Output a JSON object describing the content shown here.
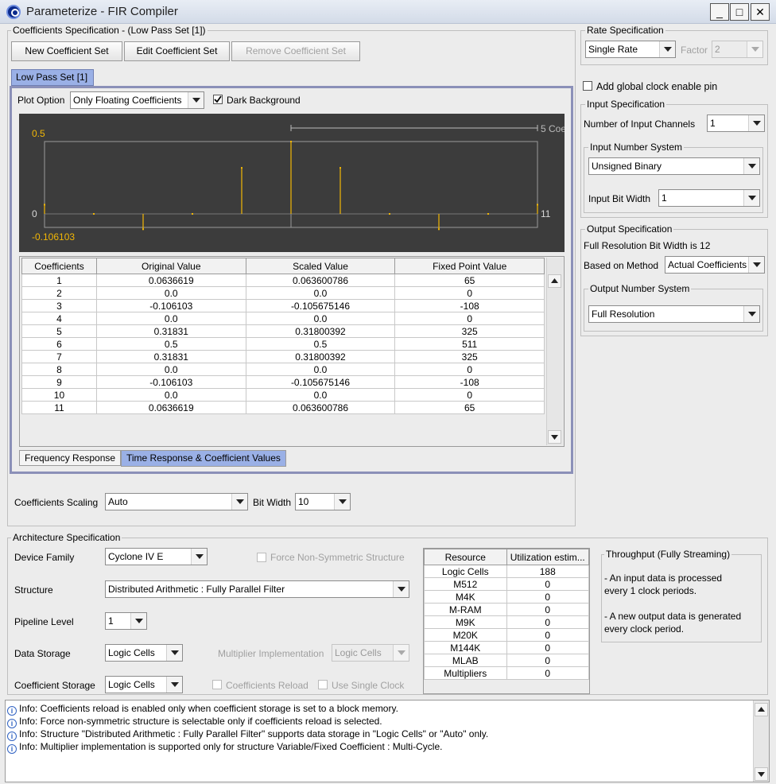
{
  "window": {
    "title": "Parameterize - FIR Compiler"
  },
  "coefficients_spec": {
    "title": "Coefficients Specification - (Low Pass Set [1])",
    "new_btn": "New Coefficient Set",
    "edit_btn": "Edit Coefficient Set",
    "remove_btn": "Remove Coefficient Set",
    "set_tab": "Low Pass Set [1]",
    "plot_option_label": "Plot Option",
    "plot_option_value": "Only Floating Coefficients",
    "dark_bg_label": "Dark Background",
    "plot": {
      "y_top": "0.5",
      "y_zero": "0",
      "y_bottom": "-0.106103",
      "x_end": "11",
      "range_label": "5 Coe",
      "values": [
        0.0636619,
        0.0,
        -0.106103,
        0.0,
        0.31831,
        0.5,
        0.31831,
        0.0,
        -0.106103,
        0.0,
        0.0636619
      ],
      "line_color": "#f2b705",
      "bg_color": "#3c3c3c"
    },
    "table": {
      "headers": [
        "Coefficients",
        "Original Value",
        "Scaled Value",
        "Fixed Point Value"
      ],
      "rows": [
        [
          "1",
          "0.0636619",
          "0.063600786",
          "65"
        ],
        [
          "2",
          "0.0",
          "0.0",
          "0"
        ],
        [
          "3",
          "-0.106103",
          "-0.105675146",
          "-108"
        ],
        [
          "4",
          "0.0",
          "0.0",
          "0"
        ],
        [
          "5",
          "0.31831",
          "0.31800392",
          "325"
        ],
        [
          "6",
          "0.5",
          "0.5",
          "511"
        ],
        [
          "7",
          "0.31831",
          "0.31800392",
          "325"
        ],
        [
          "8",
          "0.0",
          "0.0",
          "0"
        ],
        [
          "9",
          "-0.106103",
          "-0.105675146",
          "-108"
        ],
        [
          "10",
          "0.0",
          "0.0",
          "0"
        ],
        [
          "11",
          "0.0636619",
          "0.063600786",
          "65"
        ]
      ]
    },
    "tabs": [
      "Frequency Response",
      "Time Response & Coefficient Values"
    ],
    "scaling_label": "Coefficients Scaling",
    "scaling_value": "Auto",
    "bitwidth_label": "Bit Width",
    "bitwidth_value": "10"
  },
  "rate_spec": {
    "title": "Rate Specification",
    "rate_value": "Single Rate",
    "factor_label": "Factor",
    "factor_value": "2"
  },
  "global_clock_label": "Add global clock enable pin",
  "input_spec": {
    "title": "Input Specification",
    "channels_label": "Number of Input Channels",
    "channels_value": "1",
    "number_system_title": "Input Number System",
    "number_system_value": "Unsigned Binary",
    "bit_width_label": "Input Bit Width",
    "bit_width_value": "1"
  },
  "output_spec": {
    "title": "Output Specification",
    "full_res_text": "Full Resolution Bit Width is 12",
    "method_label": "Based on Method",
    "method_value": "Actual Coefficients",
    "number_system_title": "Output Number System",
    "number_system_value": "Full Resolution"
  },
  "architecture": {
    "title": "Architecture Specification",
    "device_family_label": "Device Family",
    "device_family_value": "Cyclone IV E",
    "force_nonsym_label": "Force Non-Symmetric Structure",
    "structure_label": "Structure",
    "structure_value": "Distributed Arithmetic : Fully Parallel Filter",
    "pipeline_label": "Pipeline Level",
    "pipeline_value": "1",
    "data_storage_label": "Data Storage",
    "data_storage_value": "Logic Cells",
    "mult_impl_label": "Multiplier Implementation",
    "mult_impl_value": "Logic Cells",
    "coef_storage_label": "Coefficient Storage",
    "coef_storage_value": "Logic Cells",
    "coef_reload_label": "Coefficients Reload",
    "single_clock_label": "Use Single Clock"
  },
  "resources": {
    "headers": [
      "Resource",
      "Utilization estim..."
    ],
    "rows": [
      [
        "Logic Cells",
        "188"
      ],
      [
        "M512",
        "0"
      ],
      [
        "M4K",
        "0"
      ],
      [
        "M-RAM",
        "0"
      ],
      [
        "M9K",
        "0"
      ],
      [
        "M20K",
        "0"
      ],
      [
        "M144K",
        "0"
      ],
      [
        "MLAB",
        "0"
      ],
      [
        "Multipliers",
        "0"
      ]
    ]
  },
  "throughput": {
    "title": "Throughput (Fully Streaming)",
    "line1": "- An input data is processed",
    "line2": "every 1 clock periods.",
    "line3": "- A new output data is generated",
    "line4": "every clock period."
  },
  "info_messages": [
    "Info: Coefficients reload is enabled only when coefficient storage is set to a block memory.",
    "Info: Force non-symmetric structure is selectable only if coefficients reload is selected.",
    "Info: Structure \"Distributed Arithmetic : Fully Parallel Filter\" supports data storage in \"Logic Cells\" or \"Auto\" only.",
    "Info: Multiplier implementation is supported only for structure Variable/Fixed Coefficient : Multi-Cycle."
  ]
}
